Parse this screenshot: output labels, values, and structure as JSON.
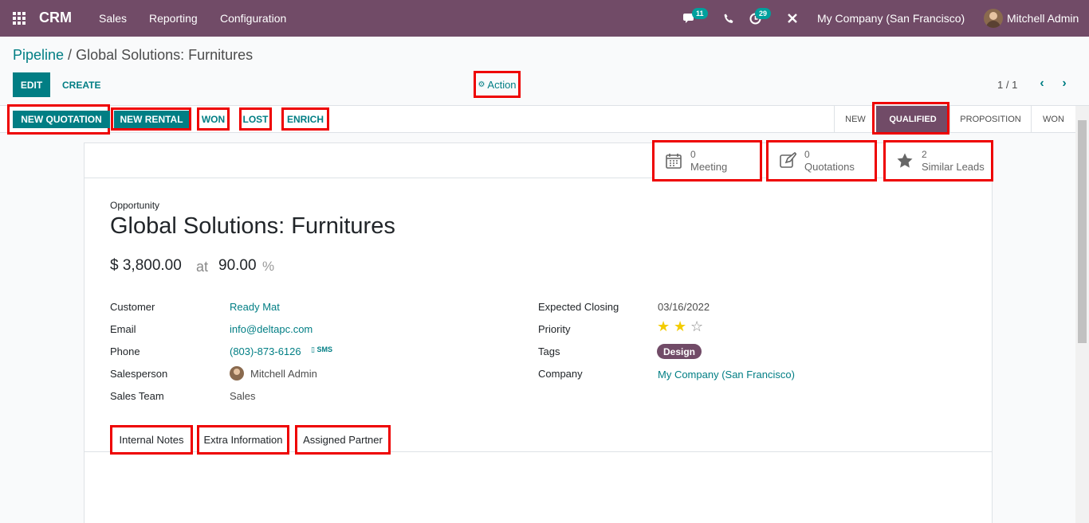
{
  "navbar": {
    "app_name": "CRM",
    "menu": [
      "Sales",
      "Reporting",
      "Configuration"
    ],
    "messages_count": "11",
    "activities_count": "29",
    "company": "My Company (San Francisco)",
    "user": "Mitchell Admin",
    "bar_color": "#714b67"
  },
  "breadcrumb": {
    "parent": "Pipeline",
    "separator": " / ",
    "current": "Global Solutions: Furnitures"
  },
  "control": {
    "edit": "EDIT",
    "create": "CREATE",
    "action": "Action",
    "pager": "1 / 1"
  },
  "header_buttons": {
    "new_quotation": "NEW QUOTATION",
    "new_rental": "NEW RENTAL",
    "won": "WON",
    "lost": "LOST",
    "enrich": "ENRICH"
  },
  "stages": [
    {
      "label": "NEW",
      "active": false
    },
    {
      "label": "QUALIFIED",
      "active": true
    },
    {
      "label": "PROPOSITION",
      "active": false
    },
    {
      "label": "WON",
      "active": false
    }
  ],
  "smart_buttons": {
    "meeting": {
      "count": "0",
      "label": "Meeting"
    },
    "quotations": {
      "count": "0",
      "label": "Quotations"
    },
    "similar": {
      "count": "2",
      "label": "Similar Leads"
    }
  },
  "record": {
    "type_label": "Opportunity",
    "name": "Global Solutions: Furnitures",
    "expected_revenue": "$ 3,800.00",
    "at": "at",
    "probability": "90.00",
    "percent": "%"
  },
  "fields_left": {
    "customer_label": "Customer",
    "customer": "Ready Mat",
    "email_label": "Email",
    "email": "info@deltapc.com",
    "phone_label": "Phone",
    "phone": "(803)-873-6126",
    "sms": "SMS",
    "salesperson_label": "Salesperson",
    "salesperson": "Mitchell Admin",
    "team_label": "Sales Team",
    "team": "Sales"
  },
  "fields_right": {
    "closing_label": "Expected Closing",
    "closing": "03/16/2022",
    "priority_label": "Priority",
    "priority_stars": 2,
    "priority_max": 3,
    "tags_label": "Tags",
    "tag": "Design",
    "company_label": "Company",
    "company": "My Company (San Francisco)"
  },
  "tabs": {
    "internal_notes": "Internal Notes",
    "extra_info": "Extra Information",
    "assigned_partner": "Assigned Partner"
  }
}
